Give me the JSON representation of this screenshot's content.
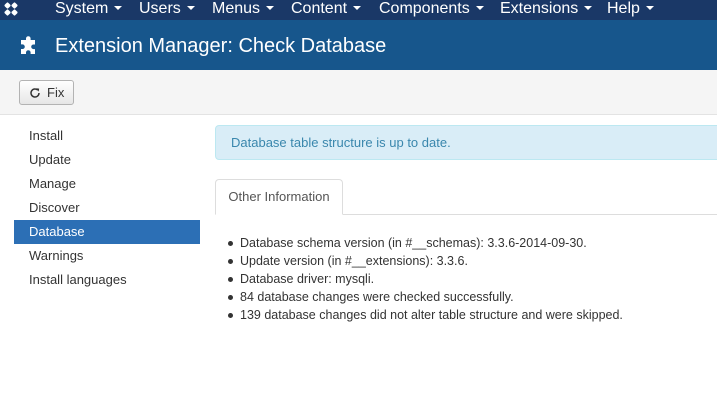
{
  "menubar": {
    "items": [
      {
        "label": "System"
      },
      {
        "label": "Users"
      },
      {
        "label": "Menus"
      },
      {
        "label": "Content"
      },
      {
        "label": "Components"
      },
      {
        "label": "Extensions"
      },
      {
        "label": "Help"
      }
    ]
  },
  "header": {
    "title": "Extension Manager: Check Database",
    "icon": "puzzle-icon"
  },
  "toolbar": {
    "fix_label": "Fix",
    "fix_icon": "refresh-icon"
  },
  "sidebar": {
    "items": [
      {
        "label": "Install",
        "active": false
      },
      {
        "label": "Update",
        "active": false
      },
      {
        "label": "Manage",
        "active": false
      },
      {
        "label": "Discover",
        "active": false
      },
      {
        "label": "Database",
        "active": true
      },
      {
        "label": "Warnings",
        "active": false
      },
      {
        "label": "Install languages",
        "active": false
      }
    ]
  },
  "alert": {
    "message": "Database table structure is up to date."
  },
  "tabs": [
    {
      "label": "Other Information",
      "active": true
    }
  ],
  "info": {
    "items": [
      "Database schema version (in #__schemas): 3.3.6-2014-09-30.",
      "Update version (in #__extensions): 3.3.6.",
      "Database driver: mysqli.",
      "84 database changes were checked successfully.",
      "139 database changes did not alter table structure and were skipped."
    ]
  },
  "colors": {
    "menubar_bg": "#1a3867",
    "titlebar_bg": "#17568c",
    "sidebar_active_bg": "#2c6fb5",
    "alert_bg": "#d9edf7",
    "alert_text": "#3a87ad"
  }
}
